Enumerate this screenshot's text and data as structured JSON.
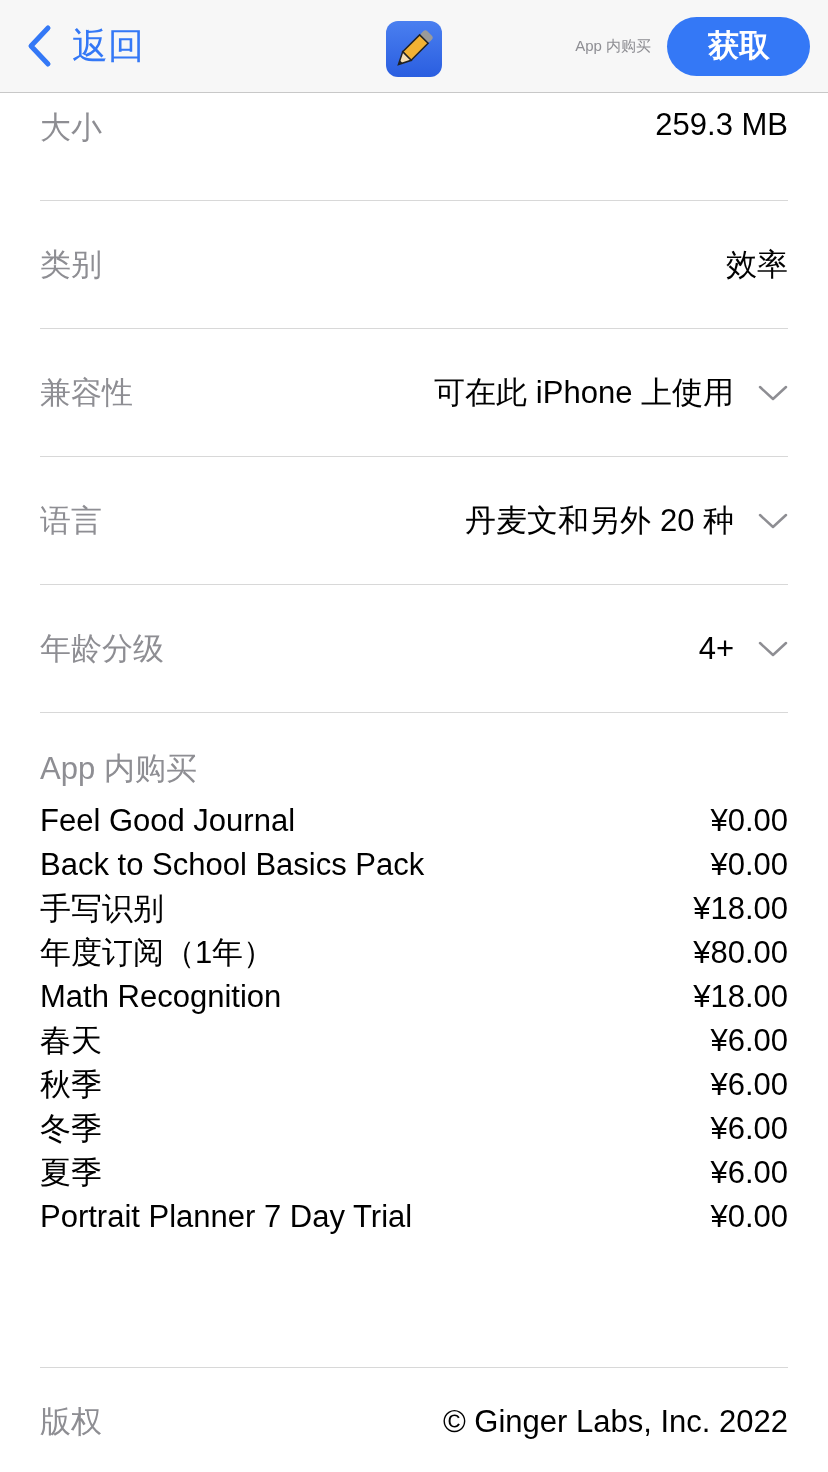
{
  "nav": {
    "back": "返回",
    "iap_note": "App 内购买",
    "get_button": "获取"
  },
  "info_rows": [
    {
      "label": "大小",
      "value": "259.3 MB",
      "expandable": false
    },
    {
      "label": "类别",
      "value": "效率",
      "expandable": false
    },
    {
      "label": "兼容性",
      "value": "可在此 iPhone 上使用",
      "expandable": true
    },
    {
      "label": "语言",
      "value": "丹麦文和另外 20 种",
      "expandable": true
    },
    {
      "label": "年龄分级",
      "value": "4+",
      "expandable": true
    }
  ],
  "in_app_purchases": {
    "title": "App 内购买",
    "items": [
      {
        "name": "Feel Good Journal",
        "price": "¥0.00"
      },
      {
        "name": "Back to School Basics Pack",
        "price": "¥0.00"
      },
      {
        "name": "手写识别",
        "price": "¥18.00"
      },
      {
        "name": "年度订阅（1年）",
        "price": "¥80.00"
      },
      {
        "name": "Math Recognition",
        "price": "¥18.00"
      },
      {
        "name": "春天",
        "price": "¥6.00"
      },
      {
        "name": "秋季",
        "price": "¥6.00"
      },
      {
        "name": "冬季",
        "price": "¥6.00"
      },
      {
        "name": "夏季",
        "price": "¥6.00"
      },
      {
        "name": "Portrait Planner 7 Day Trial",
        "price": "¥0.00"
      }
    ]
  },
  "copyright": {
    "label": "版权",
    "value": "© Ginger Labs, Inc. 2022"
  }
}
